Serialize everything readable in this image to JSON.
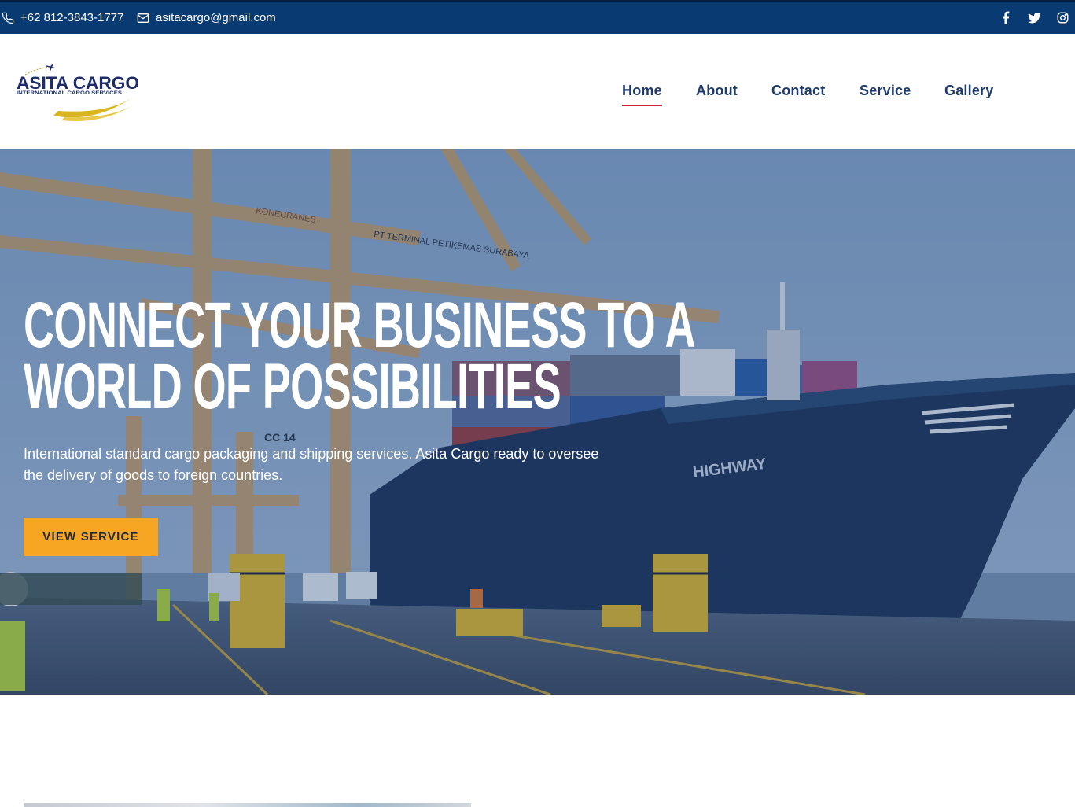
{
  "topbar": {
    "phone": "+62 812-3843-1777",
    "email": "asitacargo@gmail.com",
    "phone_icon": "phone-icon",
    "email_icon": "envelope-icon",
    "social": [
      "facebook-icon",
      "twitter-icon",
      "instagram-icon"
    ],
    "bg_color": "#0a3a72"
  },
  "brand": {
    "name": "ASITA CARGO",
    "tagline": "INTERNATIONAL CARGO SERVICES"
  },
  "nav": {
    "items": [
      {
        "label": "Home",
        "active": true
      },
      {
        "label": "About"
      },
      {
        "label": "Contact"
      },
      {
        "label": "Service"
      },
      {
        "label": "Gallery"
      }
    ],
    "active_color": "#d11e3a",
    "text_color": "#1d3b6a"
  },
  "hero": {
    "title_line1": "CONNECT YOUR BUSINESS TO A",
    "title_line2": "WORLD OF POSSIBILITIES",
    "description": "International standard cargo packaging and shipping services. Asita Cargo ready to oversee the delivery of goods to foreign countries.",
    "cta_label": "VIEW SERVICE",
    "cta_color": "#f7a623",
    "scene": {
      "crane_text": "PT TERMINAL PETIKEMAS SURABAYA",
      "ship_name": "HIGHWAY",
      "crane_brand": "KONECRANES",
      "crane_code": "CC 14"
    }
  }
}
